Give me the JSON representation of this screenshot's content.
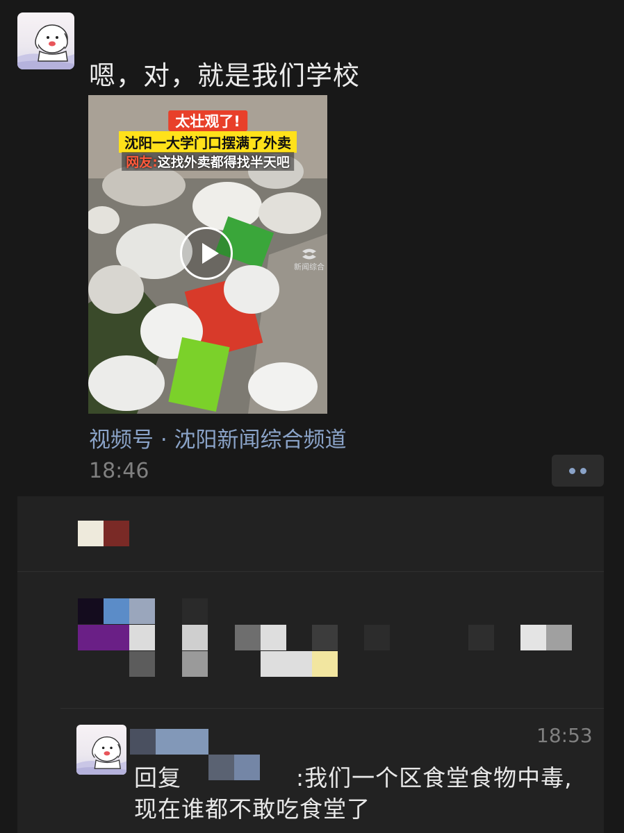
{
  "post": {
    "text": "嗯，对，就是我们学校",
    "video": {
      "caption_line1": "太壮观了!",
      "caption_line2": "沈阳一大学门口摆满了外卖",
      "caption_line3_speaker": "网友:",
      "caption_line3_text": "这找外卖都得找半天吧",
      "watermark_line1": "新闻综合"
    },
    "channel": "视频号 · 沈阳新闻综合频道",
    "time": "18:46",
    "more_icon": "ellipsis-icon"
  },
  "comment": {
    "time": "18:53",
    "reply_prefix": "回复",
    "text_line1": ":我们一个区食堂食物中毒,",
    "text_line2": "现在谁都不敢吃食堂了"
  },
  "colors": {
    "background": "#181818",
    "panel": "#222222",
    "link": "#8aa3c8",
    "timestamp": "#808080"
  }
}
